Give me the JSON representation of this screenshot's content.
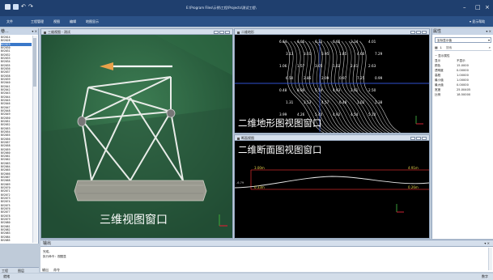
{
  "titlebar": {
    "title": "E:\\Program Files\\示例\\工程\\Projects\\测试工程\\"
  },
  "menubar": {
    "items": [
      "文件",
      "工程管理",
      "视图",
      "编辑",
      "地图显示"
    ],
    "right": "▾ 显示帮助"
  },
  "left_panel": {
    "title": "巷...",
    "items": [
      "BV2014",
      "BV2028",
      "BV2029",
      "BV2030",
      "BV2031",
      "BV2032",
      "BV2033",
      "BV2034",
      "BV2035",
      "BV2036",
      "BV2037",
      "BV2038",
      "BV2039",
      "BV2040",
      "BV2041",
      "BV2042",
      "BV2043",
      "BV2044",
      "BV2045",
      "BV2046",
      "BV2047",
      "BV2048",
      "BV2049",
      "BV2050",
      "BV2051",
      "BV2052",
      "BV2053",
      "BV2054",
      "BV2055",
      "BV2056",
      "BV2057",
      "BV2058",
      "BV2059",
      "BV2060",
      "BV2061",
      "BV2062",
      "BV2063",
      "BV2064",
      "BV2065",
      "BV2066",
      "BV2067",
      "BV2068",
      "BV2069",
      "BV2070",
      "BV2071",
      "BV2072",
      "BV2073",
      "BV2074",
      "BV2075",
      "BV2076",
      "BV2077",
      "BV2078",
      "BV2079",
      "BV2080",
      "BV2081",
      "BV2082",
      "BV2083",
      "BV2084",
      "BV2085"
    ],
    "selected_index": 2,
    "tabs": [
      "工程",
      "图层"
    ]
  },
  "view3d": {
    "tab": "三维视图 - 测试",
    "label": "三维视图窗口"
  },
  "topo": {
    "tab": "二维地形",
    "label": "二维地形图视图窗口",
    "values": [
      "6.64",
      "6.00",
      "6.33",
      "6.65",
      "3.34",
      "4.01",
      "3.13",
      "3.01",
      "3.95",
      "1.85",
      "4.60",
      "7.29",
      "1.06",
      "1.57",
      "3.05",
      "1.02",
      "2.41",
      "2.63",
      "6.50",
      "2.86",
      "2.09",
      "0.97",
      "7.25",
      "0.99",
      "0.48",
      "8.00",
      "5.54",
      "4.93",
      "2.61",
      "2.50",
      "1.31",
      "3.53",
      "4.57",
      "6.48",
      "1.02",
      "1.38",
      "3.99",
      "4.26",
      "5.40",
      "4.92",
      "4.54",
      "5.10"
    ]
  },
  "section": {
    "tab": "断面视图",
    "label": "二维断面图视图窗口",
    "top_left": "3.00m",
    "top_right": "4.91m",
    "bottom_left": "0.33m",
    "bottom_right": "0.26m",
    "left_value": "-6.79"
  },
  "props": {
    "title": "属性",
    "dropdown": "坐标显示值",
    "search": "搜索",
    "group": "显示属性",
    "rows": [
      {
        "k": "显示",
        "v": "不显示"
      },
      {
        "k": "颜色",
        "v": "15.0000"
      },
      {
        "k": "透明度",
        "v": "0.00000"
      },
      {
        "k": "高程",
        "v": "1.00000"
      },
      {
        "k": "最小值",
        "v": "1.00000"
      },
      {
        "k": "最大值",
        "v": "0.00000"
      },
      {
        "k": "宽度",
        "v": "25.00405"
      },
      {
        "k": "比例",
        "v": "18.50000"
      }
    ]
  },
  "output": {
    "title": "输出",
    "lines": [
      "完成。",
      "执行命令：视图显"
    ]
  },
  "output_tabs": [
    "输出",
    "命令"
  ],
  "status": {
    "left": "就绪",
    "right": "数字"
  }
}
